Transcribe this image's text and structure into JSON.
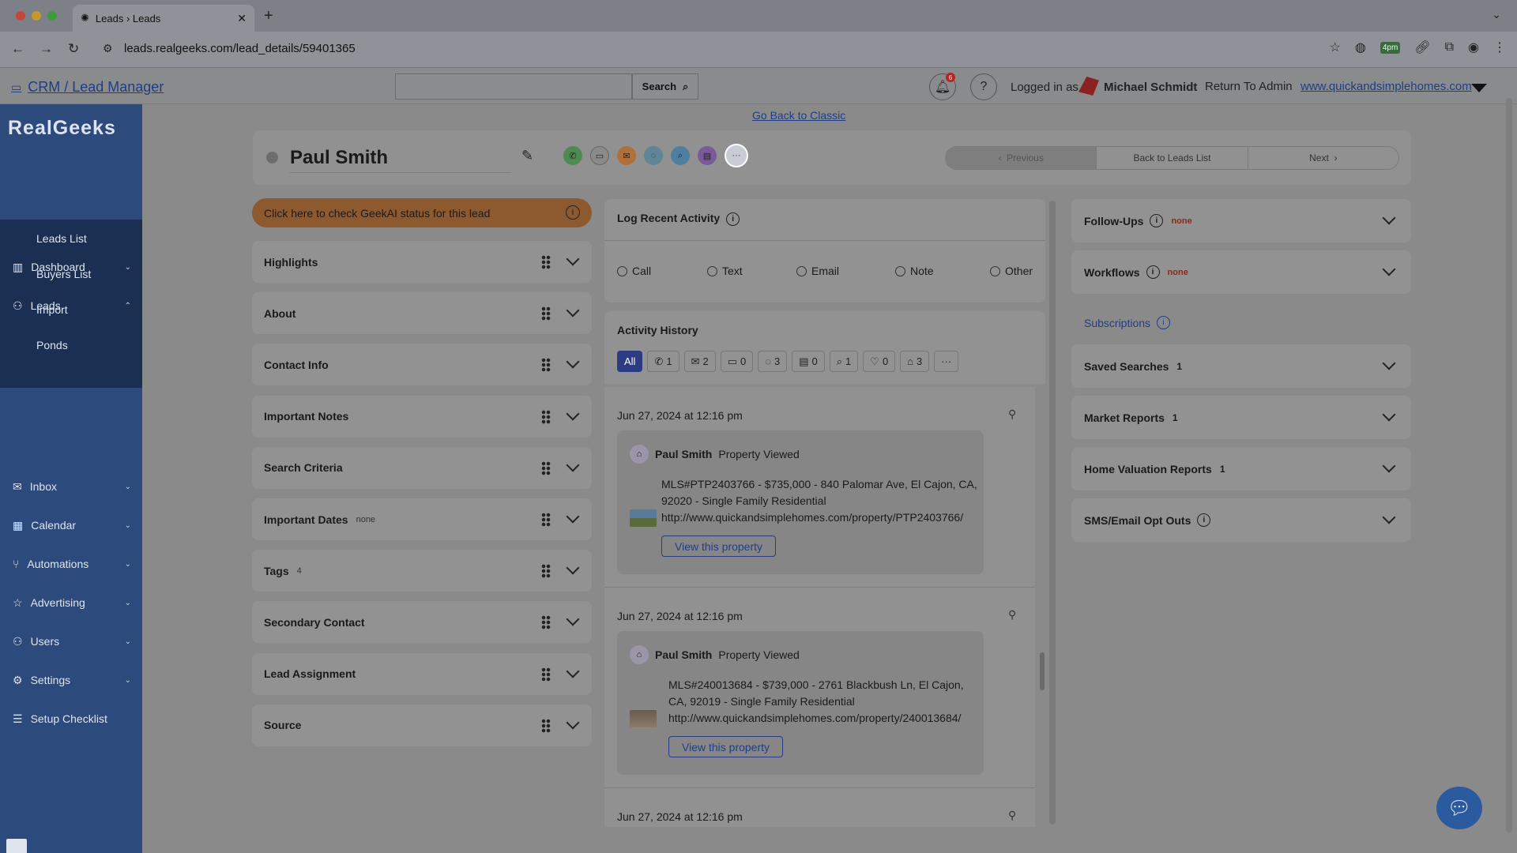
{
  "browser": {
    "tab_title": "Leads › Leads",
    "url": "leads.realgeeks.com/lead_details/59401365",
    "ext_badge": "4pm"
  },
  "header": {
    "crm_link": "CRM / Lead Manager",
    "search_placeholder": "",
    "search_label": "Search",
    "notif_count": "6",
    "logged_in_label": "Logged in as",
    "user_name": "Michael Schmidt",
    "return_admin": "Return To Admin",
    "site_link": "www.quickandsimplehomes.com"
  },
  "sidebar": {
    "logo": "RealGeeks",
    "items": [
      {
        "label": "Dashboard",
        "icon": "chart-icon",
        "glyph": "▥"
      },
      {
        "label": "Leads",
        "icon": "people-icon",
        "glyph": "⚇"
      },
      {
        "label": "Inbox",
        "icon": "mail-icon",
        "glyph": "✉"
      },
      {
        "label": "Calendar",
        "icon": "calendar-icon",
        "glyph": "▦"
      },
      {
        "label": "Automations",
        "icon": "fork-icon",
        "glyph": "⑂"
      },
      {
        "label": "Advertising",
        "icon": "star-icon",
        "glyph": "☆"
      },
      {
        "label": "Users",
        "icon": "user-icon",
        "glyph": "⚇"
      },
      {
        "label": "Settings",
        "icon": "gear-icon",
        "glyph": "⚙"
      },
      {
        "label": "Setup Checklist",
        "icon": "checklist-icon",
        "glyph": "☰"
      }
    ],
    "leads_sub": [
      "Leads List",
      "Buyers List",
      "Import",
      "Ponds"
    ]
  },
  "main": {
    "classic_link": "Go Back to Classic",
    "lead_name": "Paul Smith",
    "pager": {
      "prev": "Previous",
      "back": "Back to Leads List",
      "next": "Next"
    },
    "geekai": "Click here to check GeekAI status for this lead",
    "left_panels": [
      {
        "label": "Highlights",
        "count": ""
      },
      {
        "label": "About",
        "count": ""
      },
      {
        "label": "Contact Info",
        "count": ""
      },
      {
        "label": "Important Notes",
        "count": ""
      },
      {
        "label": "Search Criteria",
        "count": ""
      },
      {
        "label": "Important Dates",
        "count": "none"
      },
      {
        "label": "Tags",
        "count": "4"
      },
      {
        "label": "Secondary Contact",
        "count": ""
      },
      {
        "label": "Lead Assignment",
        "count": ""
      },
      {
        "label": "Source",
        "count": ""
      }
    ],
    "log": {
      "title": "Log Recent Activity",
      "options": [
        "Call",
        "Text",
        "Email",
        "Note",
        "Other"
      ]
    },
    "history": {
      "title": "Activity History",
      "filters": [
        {
          "icon": "",
          "count": "All"
        },
        {
          "icon": "phone-icon",
          "glyph": "✆",
          "count": "1"
        },
        {
          "icon": "email-icon",
          "glyph": "✉",
          "count": "2"
        },
        {
          "icon": "text-icon",
          "glyph": "▭",
          "count": "0"
        },
        {
          "icon": "chat-icon",
          "glyph": "◌",
          "count": "3"
        },
        {
          "icon": "note-icon",
          "glyph": "▤",
          "count": "0"
        },
        {
          "icon": "search-icon",
          "glyph": "⌕",
          "count": "1"
        },
        {
          "icon": "heart-icon",
          "glyph": "♡",
          "count": "0"
        },
        {
          "icon": "house-icon",
          "glyph": "⌂",
          "count": "3"
        },
        {
          "icon": "more-icon",
          "glyph": "···",
          "count": ""
        }
      ],
      "entries": [
        {
          "date": "Jun 27, 2024 at 12:16 pm",
          "name": "Paul Smith",
          "action": "Property Viewed",
          "line1": "MLS#PTP2403766 - $735,000 - 840 Palomar Ave, El Cajon, CA, 92020 - Single Family Residential",
          "line2": "http://www.quickandsimplehomes.com/property/PTP2403766/",
          "button": "View this property"
        },
        {
          "date": "Jun 27, 2024 at 12:16 pm",
          "name": "Paul Smith",
          "action": "Property Viewed",
          "line1": "MLS#240013684 - $739,000 - 2761 Blackbush Ln, El Cajon, CA, 92019 - Single Family Residential",
          "line2": "http://www.quickandsimplehomes.com/property/240013684/",
          "button": "View this property"
        },
        {
          "date": "Jun 27, 2024 at 12:16 pm"
        }
      ]
    },
    "right_panels": [
      {
        "label": "Follow-Ups",
        "info": true,
        "tag": "none",
        "count": ""
      },
      {
        "label": "Workflows",
        "info": true,
        "tag": "none",
        "count": ""
      },
      {
        "label": "Saved Searches",
        "info": false,
        "tag": "",
        "count": "1"
      },
      {
        "label": "Market Reports",
        "info": false,
        "tag": "",
        "count": "1"
      },
      {
        "label": "Home Valuation Reports",
        "info": false,
        "tag": "",
        "count": "1"
      },
      {
        "label": "SMS/Email Opt Outs",
        "info": true,
        "tag": "",
        "count": ""
      }
    ],
    "subscriptions": "Subscriptions"
  }
}
